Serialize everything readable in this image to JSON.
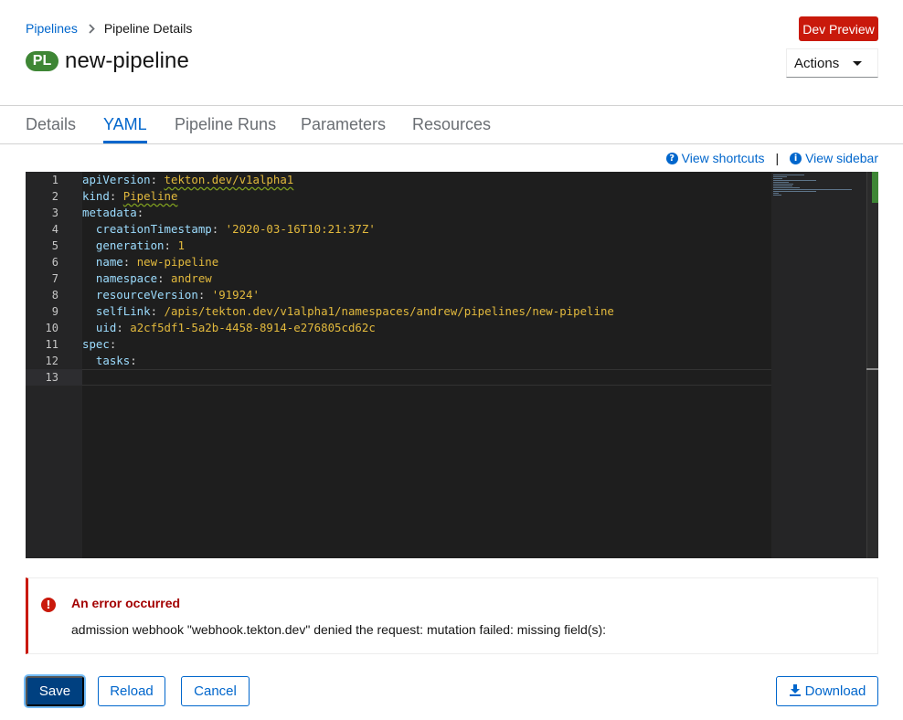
{
  "breadcrumb": {
    "parent": "Pipelines",
    "current": "Pipeline Details"
  },
  "header": {
    "badge": "PL",
    "title": "new-pipeline",
    "dev_preview": "Dev Preview",
    "actions_label": "Actions"
  },
  "tabs": [
    {
      "label": "Details"
    },
    {
      "label": "YAML"
    },
    {
      "label": "Pipeline Runs"
    },
    {
      "label": "Parameters"
    },
    {
      "label": "Resources"
    }
  ],
  "active_tab": "YAML",
  "shortcuts": {
    "view_shortcuts": "View shortcuts",
    "separator": "|",
    "view_sidebar": "View sidebar"
  },
  "editor": {
    "lines": [
      {
        "num": "1",
        "parts": [
          [
            "k",
            "apiVersion"
          ],
          [
            "p",
            ": "
          ],
          [
            "v",
            "tekton.dev/v1alpha1"
          ]
        ]
      },
      {
        "num": "2",
        "parts": [
          [
            "k",
            "kind"
          ],
          [
            "p",
            ": "
          ],
          [
            "v",
            "Pipeline"
          ]
        ]
      },
      {
        "num": "3",
        "parts": [
          [
            "k",
            "metadata"
          ],
          [
            "p",
            ":"
          ]
        ]
      },
      {
        "num": "4",
        "parts": [
          [
            "p",
            "  "
          ],
          [
            "k",
            "creationTimestamp"
          ],
          [
            "p",
            ": "
          ],
          [
            "v",
            "'2020-03-16T10:21:37Z'"
          ]
        ]
      },
      {
        "num": "5",
        "parts": [
          [
            "p",
            "  "
          ],
          [
            "k",
            "generation"
          ],
          [
            "p",
            ": "
          ],
          [
            "v",
            "1"
          ]
        ]
      },
      {
        "num": "6",
        "parts": [
          [
            "p",
            "  "
          ],
          [
            "k",
            "name"
          ],
          [
            "p",
            ": "
          ],
          [
            "v",
            "new-pipeline"
          ]
        ]
      },
      {
        "num": "7",
        "parts": [
          [
            "p",
            "  "
          ],
          [
            "k",
            "namespace"
          ],
          [
            "p",
            ": "
          ],
          [
            "v",
            "andrew"
          ]
        ]
      },
      {
        "num": "8",
        "parts": [
          [
            "p",
            "  "
          ],
          [
            "k",
            "resourceVersion"
          ],
          [
            "p",
            ": "
          ],
          [
            "v",
            "'91924'"
          ]
        ]
      },
      {
        "num": "9",
        "parts": [
          [
            "p",
            "  "
          ],
          [
            "k",
            "selfLink"
          ],
          [
            "p",
            ": "
          ],
          [
            "v",
            "/apis/tekton.dev/v1alpha1/namespaces/andrew/pipelines/new-pipeline"
          ]
        ]
      },
      {
        "num": "10",
        "parts": [
          [
            "p",
            "  "
          ],
          [
            "k",
            "uid"
          ],
          [
            "p",
            ": "
          ],
          [
            "v",
            "a2cf5df1-5a2b-4458-8914-e276805cd62c"
          ]
        ]
      },
      {
        "num": "11",
        "parts": [
          [
            "k",
            "spec"
          ],
          [
            "p",
            ":"
          ]
        ]
      },
      {
        "num": "12",
        "parts": [
          [
            "p",
            "  "
          ],
          [
            "k",
            "tasks"
          ],
          [
            "p",
            ":"
          ]
        ]
      },
      {
        "num": "13",
        "parts": []
      }
    ]
  },
  "alert": {
    "title": "An error occurred",
    "message": "admission webhook \"webhook.tekton.dev\" denied the request: mutation failed: missing field(s):"
  },
  "buttons": {
    "save": "Save",
    "reload": "Reload",
    "cancel": "Cancel",
    "download": "Download"
  },
  "colors": {
    "accent": "#0066cc",
    "danger": "#c9190b",
    "badge": "#3e8635"
  }
}
